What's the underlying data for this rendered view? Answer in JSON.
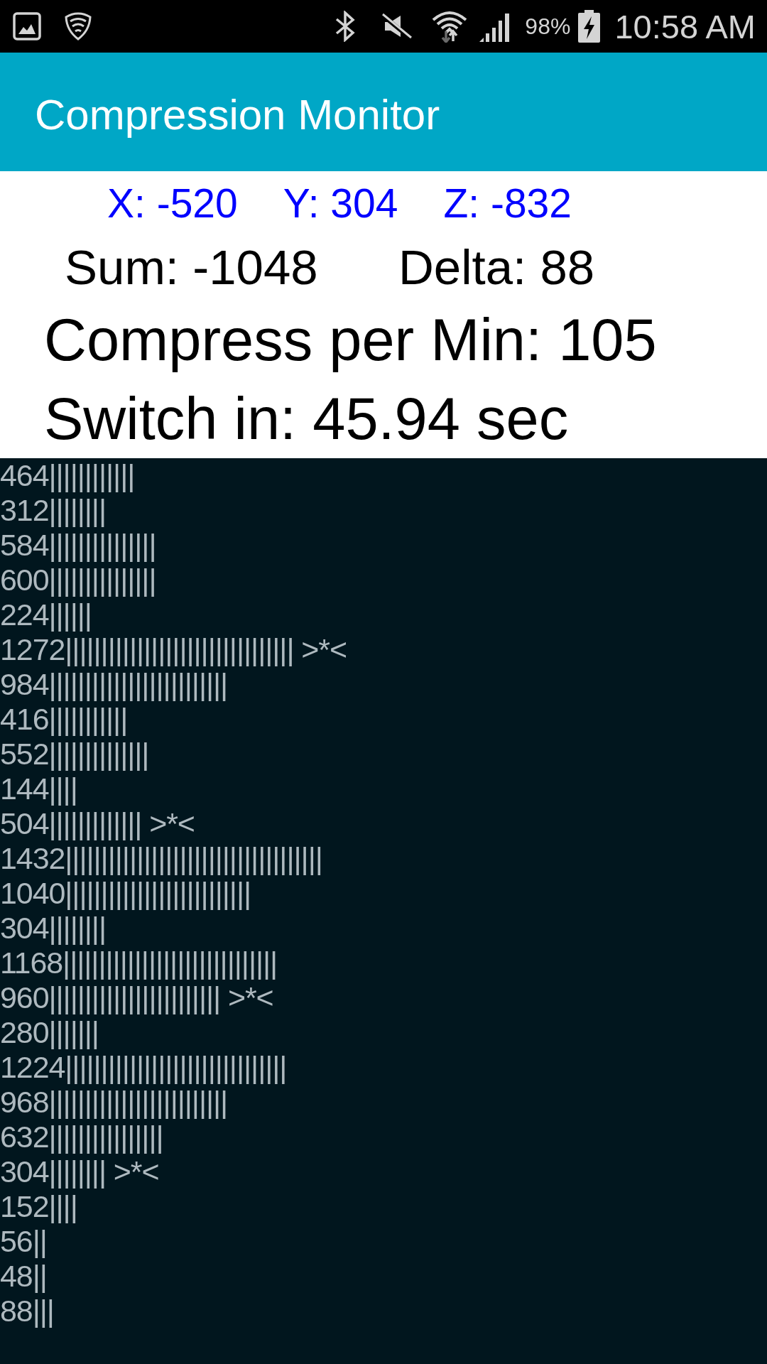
{
  "status_bar": {
    "battery": "98%",
    "time": "10:58 AM"
  },
  "app_bar": {
    "title": "Compression Monitor"
  },
  "readings": {
    "axes": [
      "X: -520",
      "Y: 304",
      "Z: -832"
    ],
    "sum": "Sum: -1048",
    "delta": "Delta: 88",
    "compress_per_min": "Compress per Min: 105",
    "switch_in": "Switch in: 45.94 sec"
  },
  "log": [
    "464||||||||||||",
    "312||||||||",
    "584|||||||||||||||",
    "600|||||||||||||||",
    "224||||||",
    "1272|||||||||||||||||||||||||||||||| >*<",
    "984|||||||||||||||||||||||||",
    "416|||||||||||",
    "552||||||||||||||",
    "144||||",
    "504||||||||||||| >*<",
    "1432||||||||||||||||||||||||||||||||||||",
    "1040||||||||||||||||||||||||||",
    "304||||||||",
    "1168||||||||||||||||||||||||||||||",
    "960|||||||||||||||||||||||| >*<",
    "280|||||||",
    "1224|||||||||||||||||||||||||||||||",
    "968|||||||||||||||||||||||||",
    "632||||||||||||||||",
    "304|||||||| >*<",
    "152||||",
    "56||",
    "48||",
    "88|||"
  ]
}
